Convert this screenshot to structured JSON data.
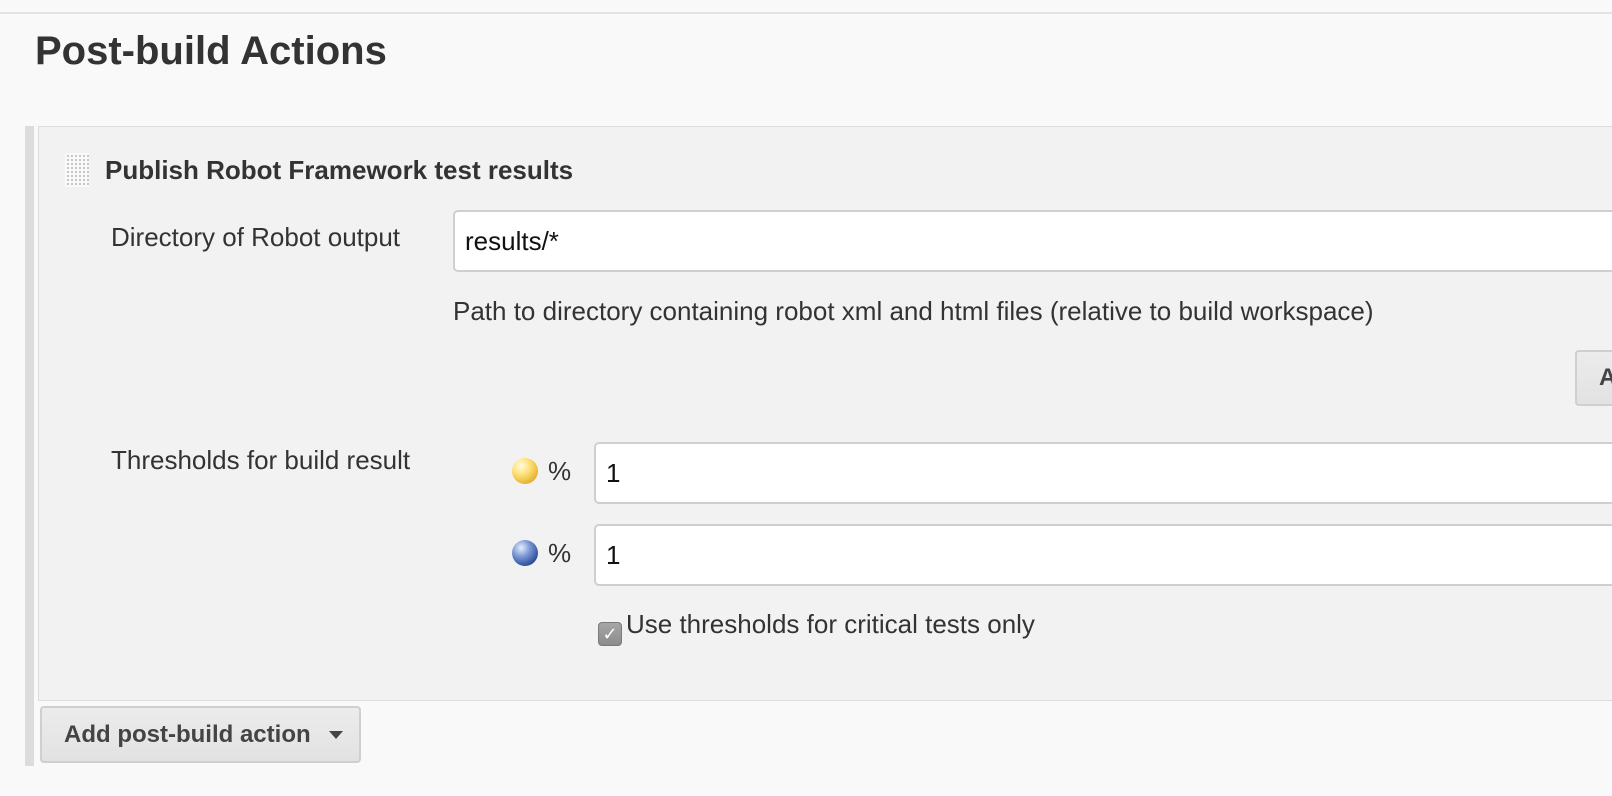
{
  "section": {
    "title": "Post-build Actions"
  },
  "action": {
    "title": "Publish Robot Framework test results",
    "directory": {
      "label": "Directory of Robot output",
      "value": "results/*",
      "help": "Path to directory containing robot xml and html files (relative to build workspace)"
    },
    "advanced_button_label": "A",
    "thresholds": {
      "label": "Thresholds for build result",
      "unstable": {
        "icon": "yellow-ball-icon",
        "unit": "%",
        "value": "1"
      },
      "pass": {
        "icon": "blue-ball-icon",
        "unit": "%",
        "value": "1"
      }
    },
    "critical_only": {
      "checked": true,
      "label": "Use thresholds for critical tests only"
    }
  },
  "add_action_button": {
    "label": "Add post-build action",
    "icon": "caret-down-icon"
  }
}
